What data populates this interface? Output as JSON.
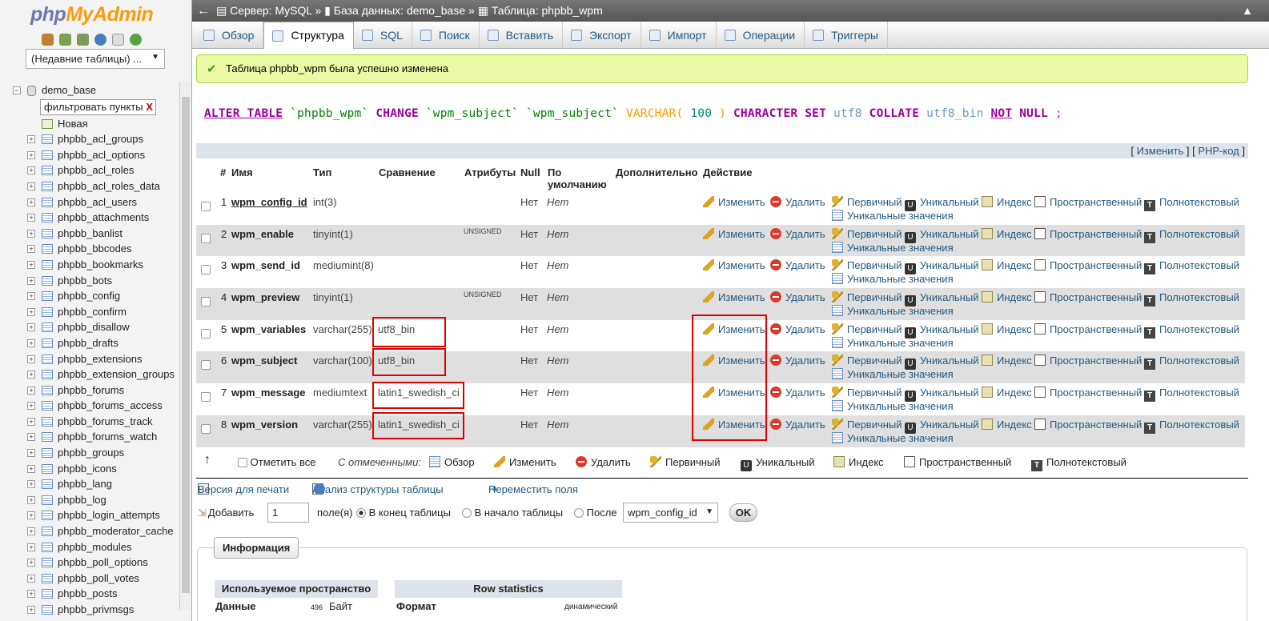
{
  "app": {
    "logo_php": "php",
    "logo_myadmin": "MyAdmin"
  },
  "sidebar": {
    "recent_select": "(Недавние таблицы) ...",
    "database": "demo_base",
    "filter_value": "фильтровать пункты",
    "new_item": "Новая",
    "tables": [
      "phpbb_acl_groups",
      "phpbb_acl_options",
      "phpbb_acl_roles",
      "phpbb_acl_roles_data",
      "phpbb_acl_users",
      "phpbb_attachments",
      "phpbb_banlist",
      "phpbb_bbcodes",
      "phpbb_bookmarks",
      "phpbb_bots",
      "phpbb_config",
      "phpbb_confirm",
      "phpbb_disallow",
      "phpbb_drafts",
      "phpbb_extensions",
      "phpbb_extension_groups",
      "phpbb_forums",
      "phpbb_forums_access",
      "phpbb_forums_track",
      "phpbb_forums_watch",
      "phpbb_groups",
      "phpbb_icons",
      "phpbb_lang",
      "phpbb_log",
      "phpbb_login_attempts",
      "phpbb_moderator_cache",
      "phpbb_modules",
      "phpbb_poll_options",
      "phpbb_poll_votes",
      "phpbb_posts",
      "phpbb_privmsgs"
    ]
  },
  "breadcrumb": {
    "server": "Сервер: MySQL »",
    "database": "База данных: demo_base »",
    "table": "Таблица: phpbb_wpm"
  },
  "tabs": [
    "Обзор",
    "Структура",
    "SQL",
    "Поиск",
    "Вставить",
    "Экспорт",
    "Импорт",
    "Операции",
    "Триггеры"
  ],
  "success_message": "Таблица phpbb_wpm была успешно изменена",
  "sql": {
    "alter_table": "ALTER TABLE",
    "table": "`phpbb_wpm`",
    "change": "CHANGE",
    "col1": "`wpm_subject`",
    "col2": "`wpm_subject`",
    "type": "VARCHAR(",
    "len": "100",
    "close": ")",
    "charset": "CHARACTER SET",
    "charset_val": "utf8",
    "collate": "COLLATE",
    "collate_val": "utf8_bin",
    "not": "NOT",
    "null": "NULL",
    "end": ";"
  },
  "sql_links": {
    "open": "[",
    "edit": "Изменить",
    "mid": "] [",
    "php": "PHP-код",
    "close": "]"
  },
  "table_headers": {
    "num": "#",
    "name": "Имя",
    "type": "Тип",
    "collation": "Сравнение",
    "attributes": "Атрибуты",
    "null": "Null",
    "default_1": "По",
    "default_2": "умолчанию",
    "extra": "Дополнительно",
    "action": "Действие"
  },
  "rows": [
    {
      "num": "1",
      "name": "wpm_config_id",
      "type": "int(3)",
      "collation": "",
      "attributes": "",
      "null": "Нет",
      "default": "Нет"
    },
    {
      "num": "2",
      "name": "wpm_enable",
      "type": "tinyint(1)",
      "collation": "",
      "attributes": "UNSIGNED",
      "null": "Нет",
      "default": "Нет"
    },
    {
      "num": "3",
      "name": "wpm_send_id",
      "type": "mediumint(8)",
      "collation": "",
      "attributes": "",
      "null": "Нет",
      "default": "Нет"
    },
    {
      "num": "4",
      "name": "wpm_preview",
      "type": "tinyint(1)",
      "collation": "",
      "attributes": "UNSIGNED",
      "null": "Нет",
      "default": "Нет"
    },
    {
      "num": "5",
      "name": "wpm_variables",
      "type": "varchar(255)",
      "collation": "utf8_bin",
      "attributes": "",
      "null": "Нет",
      "default": "Нет"
    },
    {
      "num": "6",
      "name": "wpm_subject",
      "type": "varchar(100)",
      "collation": "utf8_bin",
      "attributes": "",
      "null": "Нет",
      "default": "Нет"
    },
    {
      "num": "7",
      "name": "wpm_message",
      "type": "mediumtext",
      "collation": "latin1_swedish_ci",
      "attributes": "",
      "null": "Нет",
      "default": "Нет"
    },
    {
      "num": "8",
      "name": "wpm_version",
      "type": "varchar(255)",
      "collation": "latin1_swedish_ci",
      "attributes": "",
      "null": "Нет",
      "default": "Нет"
    }
  ],
  "row_actions": {
    "edit": "Изменить",
    "drop": "Удалить",
    "primary": "Первичный",
    "unique": "Уникальный",
    "index": "Индекс",
    "spatial": "Пространственный",
    "fulltext": "Полнотекстовый",
    "distinct": "Уникальные значения"
  },
  "bulk": {
    "check_all": "Отметить все",
    "with_selected": "С отмеченными:",
    "browse": "Обзор",
    "edit": "Изменить",
    "drop": "Удалить",
    "primary": "Первичный",
    "unique": "Уникальный",
    "index": "Индекс",
    "spatial": "Пространственный",
    "fulltext": "Полнотекстовый"
  },
  "links": {
    "print": "Версия для печати",
    "analyze": "Анализ структуры таблицы",
    "move": "Переместить поля"
  },
  "add_fields": {
    "add": "Добавить",
    "count": "1",
    "fields": "поле(я)",
    "at_end": "В конец таблицы",
    "at_start": "В начало таблицы",
    "after": "После",
    "after_value": "wpm_config_id",
    "ok": "OK"
  },
  "info": {
    "legend": "Информация",
    "space_header": "Используемое пространство",
    "data_label": "Данные",
    "data_value": "496",
    "data_unit": "Байт",
    "row_stats_header": "Row statistics",
    "format_label": "Формат",
    "format_value": "динамический"
  }
}
